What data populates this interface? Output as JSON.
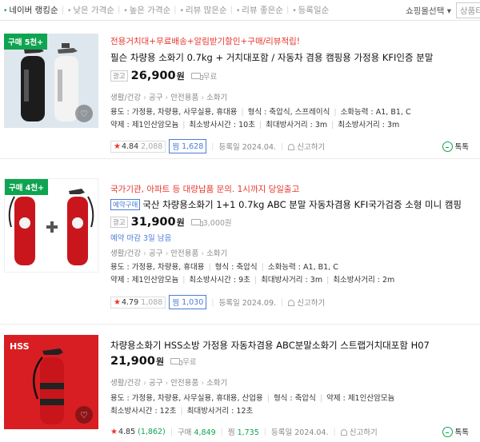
{
  "sortbar": {
    "items": [
      "네이버 랭킹순",
      "낮은 가격순",
      "높은 가격순",
      "리뷰 많은순",
      "리뷰 좋은순",
      "등록일순"
    ],
    "sort_select": "쇼핑몰선택",
    "view_toggle": "상품타"
  },
  "products": [
    {
      "badge": "구매 5천+",
      "promo": "전용거치대+무료배송+알림받기할인+구매/리뷰적립!",
      "preorder": "",
      "title": "필슨 차량용 소화기 0.7kg + 거치대포함 / 자동차 겸용 캠핑용 가정용 KFI인증 분말",
      "ad_label": "광고",
      "price": "26,900",
      "won": "원",
      "shipping": "무료",
      "deadline": "",
      "categories": [
        "생활/건강",
        "공구",
        "안전용품",
        "소화기"
      ],
      "spec_lines": [
        [
          "용도 : 가정용, 차량용, 사무실용, 휴대용",
          "형식 : 축압식, 스프레이식",
          "소화능력 : A1, B1, C"
        ],
        [
          "약제 : 제1인산암모늄",
          "최소방사시간 : 10초",
          "최대방사거리 : 3m",
          "최소방사거리 : 3m"
        ]
      ],
      "rating": "4.84",
      "review_count": "2,088",
      "jjim_label": "찜",
      "jjim_count": "1,628",
      "reg_date": "등록일 2024.04.",
      "report": "신고하기",
      "talk": "톡톡"
    },
    {
      "badge": "구매 4천+",
      "promo": "국가기관, 아파트 등 대량납품 문의. 1시까지 당일출고",
      "preorder": "예약구매",
      "title": "국산 차량용소화기 1+1 0.7kg ABC 분말 자동차겸용 KFI국가검증 소형 미니 캠핑",
      "ad_label": "광고",
      "price": "31,900",
      "won": "원",
      "shipping": "3,000원",
      "deadline": "예약 마감 3일 남음",
      "categories": [
        "생활/건강",
        "공구",
        "안전용품",
        "소화기"
      ],
      "spec_lines": [
        [
          "용도 : 가정용, 차량용, 휴대용",
          "형식 : 축압식",
          "소화능력 : A1, B1, C"
        ],
        [
          "약제 : 제1인산암모늄",
          "최소방사시간 : 9초",
          "최대방사거리 : 3m",
          "최소방사거리 : 2m"
        ]
      ],
      "rating": "4.79",
      "review_count": "1,088",
      "jjim_label": "찜",
      "jjim_count": "1,030",
      "reg_date": "등록일 2024.09.",
      "report": "신고하기",
      "talk": ""
    },
    {
      "badge": "",
      "promo": "",
      "preorder": "",
      "title": "차량용소화기 HSS소방 가정용 자동차겸용 ABC분말소화기 스트랩거치대포함 H07",
      "ad_label": "",
      "price": "21,900",
      "won": "원",
      "shipping": "무료",
      "deadline": "",
      "categories": [
        "생활/건강",
        "공구",
        "안전용품",
        "소화기"
      ],
      "spec_lines": [
        [
          "용도 : 가정용, 차량용, 사무실용, 휴대용, 산업용",
          "형식 : 축압식",
          "약제 : 제1인산암모늄"
        ],
        [
          "최소방사시간 : 12초",
          "최대방사거리 : 12초"
        ]
      ],
      "rating": "4.85",
      "review_count": "(1,862)",
      "buy_label": "구매",
      "buy_count": "4,849",
      "jjim_label": "찜",
      "jjim_count": "1,735",
      "reg_date": "등록일 2024.04.",
      "report": "신고하기",
      "talk": "톡톡",
      "brand_text": "HSS"
    }
  ],
  "colors": {
    "accent_green": "#0ea451",
    "promo_red": "#e8362d",
    "link_blue": "#4a7cd6",
    "extinguisher_red": "#c9161d",
    "hss_bg": "#d81e22"
  },
  "icons": [
    "heart-icon",
    "truck-icon",
    "siren-icon",
    "talk-icon",
    "star-icon"
  ]
}
